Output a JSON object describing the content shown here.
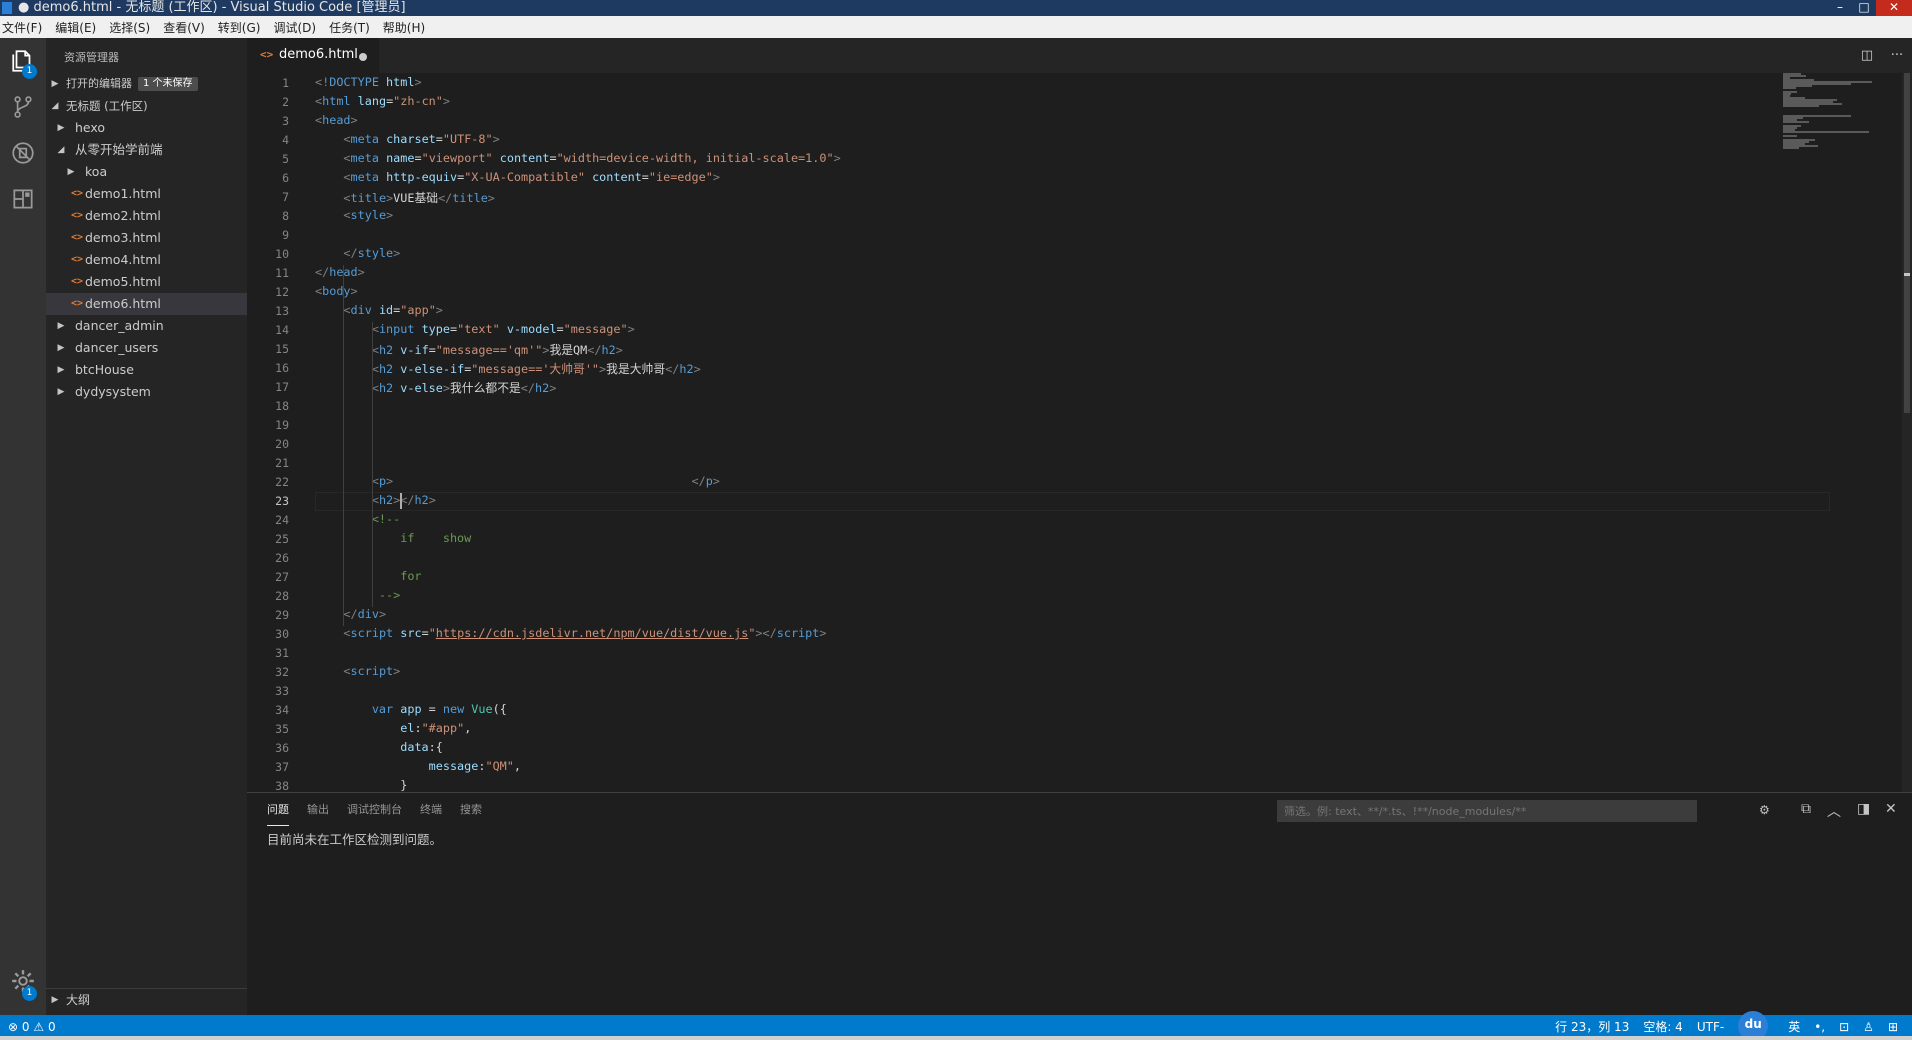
{
  "window": {
    "title": "● demo6.html - 无标题 (工作区) - Visual Studio Code [管理员]"
  },
  "menu": [
    "文件(F)",
    "编辑(E)",
    "选择(S)",
    "查看(V)",
    "转到(G)",
    "调试(D)",
    "任务(T)",
    "帮助(H)"
  ],
  "activity": {
    "explorer_badge": "1",
    "settings_badge": "1"
  },
  "sidebar": {
    "title": "资源管理器",
    "open_editors": "打开的编辑器",
    "unsaved": "1 个未保存",
    "workspace": "无标题 (工作区)",
    "items": [
      {
        "label": "hexo",
        "type": "folder",
        "expanded": false,
        "depth": 1
      },
      {
        "label": "从零开始学前端",
        "type": "folder",
        "expanded": true,
        "depth": 1
      },
      {
        "label": "koa",
        "type": "folder",
        "expanded": false,
        "depth": 2
      },
      {
        "label": "demo1.html",
        "type": "html",
        "depth": 2
      },
      {
        "label": "demo2.html",
        "type": "html",
        "depth": 2
      },
      {
        "label": "demo3.html",
        "type": "html",
        "depth": 2
      },
      {
        "label": "demo4.html",
        "type": "html",
        "depth": 2
      },
      {
        "label": "demo5.html",
        "type": "html",
        "depth": 2
      },
      {
        "label": "demo6.html",
        "type": "html",
        "depth": 2,
        "active": true
      },
      {
        "label": "dancer_admin",
        "type": "folder",
        "expanded": false,
        "depth": 1
      },
      {
        "label": "dancer_users",
        "type": "folder",
        "expanded": false,
        "depth": 1
      },
      {
        "label": "btcHouse",
        "type": "folder",
        "expanded": false,
        "depth": 1
      },
      {
        "label": "dydysystem",
        "type": "folder",
        "expanded": false,
        "depth": 1
      }
    ],
    "outline": "大纲"
  },
  "tab": {
    "label": "demo6.html"
  },
  "editor": {
    "current_line": 23,
    "lines": [
      [
        [
          "br",
          "<!"
        ],
        [
          "t",
          "DOCTYPE"
        ],
        [
          "p",
          " "
        ],
        [
          "a",
          "html"
        ],
        [
          "br",
          ">"
        ]
      ],
      [
        [
          "br",
          "<"
        ],
        [
          "t",
          "html"
        ],
        [
          "p",
          " "
        ],
        [
          "a",
          "lang"
        ],
        [
          "p",
          "="
        ],
        [
          "s",
          "\"zh-cn\""
        ],
        [
          "br",
          ">"
        ]
      ],
      [
        [
          "br",
          "<"
        ],
        [
          "t",
          "head"
        ],
        [
          "br",
          ">"
        ]
      ],
      [
        [
          "p",
          "    "
        ],
        [
          "br",
          "<"
        ],
        [
          "t",
          "meta"
        ],
        [
          "p",
          " "
        ],
        [
          "a",
          "charset"
        ],
        [
          "p",
          "="
        ],
        [
          "s",
          "\"UTF-8\""
        ],
        [
          "br",
          ">"
        ]
      ],
      [
        [
          "p",
          "    "
        ],
        [
          "br",
          "<"
        ],
        [
          "t",
          "meta"
        ],
        [
          "p",
          " "
        ],
        [
          "a",
          "name"
        ],
        [
          "p",
          "="
        ],
        [
          "s",
          "\"viewport\""
        ],
        [
          "p",
          " "
        ],
        [
          "a",
          "content"
        ],
        [
          "p",
          "="
        ],
        [
          "s",
          "\"width=device-width, initial-scale=1.0\""
        ],
        [
          "br",
          ">"
        ]
      ],
      [
        [
          "p",
          "    "
        ],
        [
          "br",
          "<"
        ],
        [
          "t",
          "meta"
        ],
        [
          "p",
          " "
        ],
        [
          "a",
          "http-equiv"
        ],
        [
          "p",
          "="
        ],
        [
          "s",
          "\"X-UA-Compatible\""
        ],
        [
          "p",
          " "
        ],
        [
          "a",
          "content"
        ],
        [
          "p",
          "="
        ],
        [
          "s",
          "\"ie=edge\""
        ],
        [
          "br",
          ">"
        ]
      ],
      [
        [
          "p",
          "    "
        ],
        [
          "br",
          "<"
        ],
        [
          "t",
          "title"
        ],
        [
          "br",
          ">"
        ],
        [
          "p",
          "VUE基础"
        ],
        [
          "br",
          "</"
        ],
        [
          "t",
          "title"
        ],
        [
          "br",
          ">"
        ]
      ],
      [
        [
          "p",
          "    "
        ],
        [
          "br",
          "<"
        ],
        [
          "t",
          "style"
        ],
        [
          "br",
          ">"
        ]
      ],
      [
        [
          "p",
          ""
        ]
      ],
      [
        [
          "p",
          "    "
        ],
        [
          "br",
          "</"
        ],
        [
          "t",
          "style"
        ],
        [
          "br",
          ">"
        ]
      ],
      [
        [
          "br",
          "</"
        ],
        [
          "t",
          "head"
        ],
        [
          "br",
          ">"
        ]
      ],
      [
        [
          "br",
          "<"
        ],
        [
          "t",
          "body"
        ],
        [
          "br",
          ">"
        ]
      ],
      [
        [
          "p",
          "    "
        ],
        [
          "br",
          "<"
        ],
        [
          "t",
          "div"
        ],
        [
          "p",
          " "
        ],
        [
          "a",
          "id"
        ],
        [
          "p",
          "="
        ],
        [
          "s",
          "\"app\""
        ],
        [
          "br",
          ">"
        ]
      ],
      [
        [
          "p",
          "        "
        ],
        [
          "br",
          "<"
        ],
        [
          "t",
          "input"
        ],
        [
          "p",
          " "
        ],
        [
          "a",
          "type"
        ],
        [
          "p",
          "="
        ],
        [
          "s",
          "\"text\""
        ],
        [
          "p",
          " "
        ],
        [
          "a",
          "v-model"
        ],
        [
          "p",
          "="
        ],
        [
          "s",
          "\"message\""
        ],
        [
          "br",
          ">"
        ]
      ],
      [
        [
          "p",
          "        "
        ],
        [
          "br",
          "<"
        ],
        [
          "t",
          "h2"
        ],
        [
          "p",
          " "
        ],
        [
          "a",
          "v-if"
        ],
        [
          "p",
          "="
        ],
        [
          "s",
          "\"message=='qm'\""
        ],
        [
          "br",
          ">"
        ],
        [
          "p",
          "我是QM"
        ],
        [
          "br",
          "</"
        ],
        [
          "t",
          "h2"
        ],
        [
          "br",
          ">"
        ]
      ],
      [
        [
          "p",
          "        "
        ],
        [
          "br",
          "<"
        ],
        [
          "t",
          "h2"
        ],
        [
          "p",
          " "
        ],
        [
          "a",
          "v-else-if"
        ],
        [
          "p",
          "="
        ],
        [
          "s",
          "\"message=='大帅哥'\""
        ],
        [
          "br",
          ">"
        ],
        [
          "p",
          "我是大帅哥"
        ],
        [
          "br",
          "</"
        ],
        [
          "t",
          "h2"
        ],
        [
          "br",
          ">"
        ]
      ],
      [
        [
          "p",
          "        "
        ],
        [
          "br",
          "<"
        ],
        [
          "t",
          "h2"
        ],
        [
          "p",
          " "
        ],
        [
          "a",
          "v-else"
        ],
        [
          "br",
          ">"
        ],
        [
          "p",
          "我什么都不是"
        ],
        [
          "br",
          "</"
        ],
        [
          "t",
          "h2"
        ],
        [
          "br",
          ">"
        ]
      ],
      [
        [
          "p",
          ""
        ]
      ],
      [
        [
          "p",
          ""
        ]
      ],
      [
        [
          "p",
          ""
        ]
      ],
      [
        [
          "p",
          ""
        ]
      ],
      [
        [
          "p",
          "        "
        ],
        [
          "br",
          "<"
        ],
        [
          "t",
          "p"
        ],
        [
          "br",
          ">"
        ],
        [
          "p",
          "                                          "
        ],
        [
          "br",
          "</"
        ],
        [
          "t",
          "p"
        ],
        [
          "br",
          ">"
        ]
      ],
      [
        [
          "p",
          "        "
        ],
        [
          "br",
          "<"
        ],
        [
          "t",
          "h2"
        ],
        [
          "br",
          ">"
        ],
        [
          "br",
          "</"
        ],
        [
          "t",
          "h2"
        ],
        [
          "br",
          ">"
        ]
      ],
      [
        [
          "p",
          "        "
        ],
        [
          "c",
          "<!--"
        ]
      ],
      [
        [
          "c",
          "            if    show"
        ]
      ],
      [
        [
          "p",
          ""
        ]
      ],
      [
        [
          "c",
          "            for"
        ]
      ],
      [
        [
          "c",
          "         -->"
        ]
      ],
      [
        [
          "p",
          "    "
        ],
        [
          "br",
          "</"
        ],
        [
          "t",
          "div"
        ],
        [
          "br",
          ">"
        ]
      ],
      [
        [
          "p",
          "    "
        ],
        [
          "br",
          "<"
        ],
        [
          "t",
          "script"
        ],
        [
          "p",
          " "
        ],
        [
          "a",
          "src"
        ],
        [
          "p",
          "="
        ],
        [
          "s",
          "\""
        ],
        [
          "u",
          "https://cdn.jsdelivr.net/npm/vue/dist/vue.js"
        ],
        [
          "s",
          "\""
        ],
        [
          "br",
          "></"
        ],
        [
          "t",
          "script"
        ],
        [
          "br",
          ">"
        ]
      ],
      [
        [
          "p",
          ""
        ]
      ],
      [
        [
          "p",
          "    "
        ],
        [
          "br",
          "<"
        ],
        [
          "t",
          "script"
        ],
        [
          "br",
          ">"
        ]
      ],
      [
        [
          "p",
          ""
        ]
      ],
      [
        [
          "p",
          "        "
        ],
        [
          "k",
          "var"
        ],
        [
          "p",
          " "
        ],
        [
          "a",
          "app"
        ],
        [
          "p",
          " = "
        ],
        [
          "k",
          "new"
        ],
        [
          "p",
          " "
        ],
        [
          "cls",
          "Vue"
        ],
        [
          "p",
          "({"
        ]
      ],
      [
        [
          "p",
          "            "
        ],
        [
          "a",
          "el"
        ],
        [
          "p",
          ":"
        ],
        [
          "s",
          "\"#app\""
        ],
        [
          "p",
          ","
        ]
      ],
      [
        [
          "p",
          "            "
        ],
        [
          "a",
          "data"
        ],
        [
          "p",
          ":{"
        ]
      ],
      [
        [
          "p",
          "                "
        ],
        [
          "a",
          "message"
        ],
        [
          "p",
          ":"
        ],
        [
          "s",
          "\"QM\""
        ],
        [
          "p",
          ","
        ]
      ],
      [
        [
          "p",
          "            }"
        ]
      ]
    ]
  },
  "panel": {
    "tabs": [
      "问题",
      "输出",
      "调试控制台",
      "终端",
      "搜索"
    ],
    "filter_placeholder": "筛选。例: text、**/*.ts、!**/node_modules/**",
    "message": "目前尚未在工作区检测到问题。"
  },
  "status": {
    "errors": "0",
    "warnings": "0",
    "position": "行 23，列 13",
    "spaces": "空格: 4",
    "encoding": "UTF-",
    "ime": "英",
    "du": "du"
  }
}
